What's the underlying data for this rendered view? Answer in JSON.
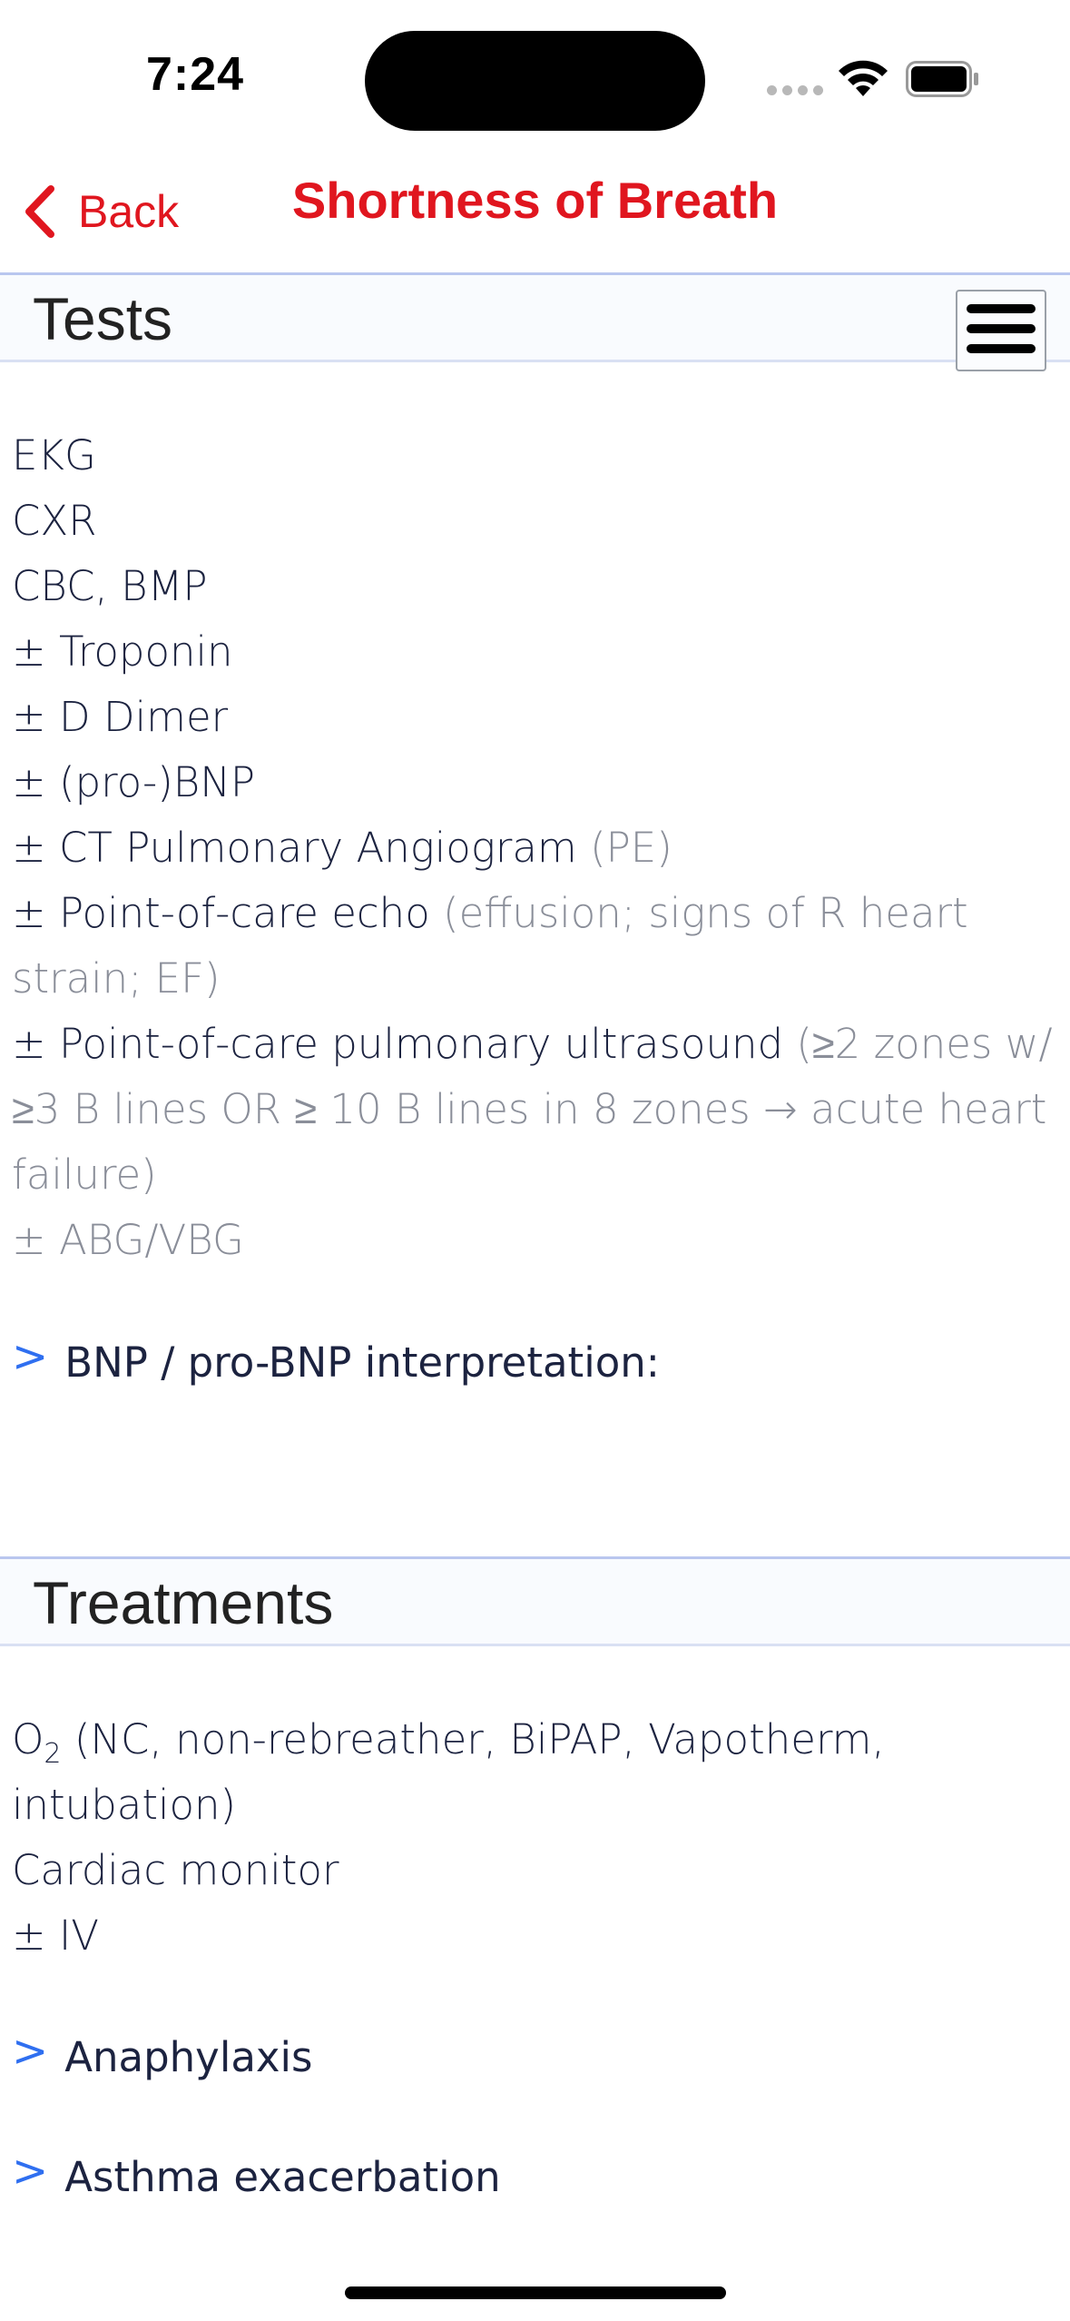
{
  "status_bar": {
    "time": "7:24",
    "icons": [
      "cellular-signal-icon",
      "wifi-icon",
      "battery-icon"
    ]
  },
  "nav": {
    "back_label": "Back",
    "title": "Shortness of Breath",
    "accent_color": "#e0161f"
  },
  "tests": {
    "header": "Tests",
    "lines": [
      {
        "main": "EKG",
        "note": ""
      },
      {
        "main": "CXR",
        "note": ""
      },
      {
        "main": "CBC, BMP",
        "note": ""
      },
      {
        "main": "± Troponin",
        "note": ""
      },
      {
        "main": "± D Dimer",
        "note": ""
      },
      {
        "main": "± (pro-)BNP",
        "note": ""
      },
      {
        "main": "± CT Pulmonary Angiogram",
        "note": "(PE)"
      },
      {
        "main": "± Point-of-care echo",
        "note": "(effusion; signs of R heart strain; EF)"
      },
      {
        "main": "± Point-of-care pulmonary ultrasound",
        "note": "(≥2 zones w/ ≥3 B lines OR ≥ 10 B lines in 8 zones → acute heart failure)"
      },
      {
        "main": "",
        "note": "± ABG/VBG"
      }
    ],
    "link": "BNP / pro-BNP interpretation:"
  },
  "treatments": {
    "header": "Treatments",
    "o2_prefix": "O",
    "o2_sub": "2",
    "o2_rest": " (NC, non-rebreather, BiPAP, Vapotherm, intubation)",
    "lines": [
      "Cardiac monitor",
      "± IV"
    ],
    "links": [
      "Anaphylaxis",
      "Asthma exacerbation"
    ]
  },
  "colors": {
    "link_chevron": "#2f6ff0",
    "muted_text": "#8a8e99",
    "body_text": "#1c2340"
  }
}
